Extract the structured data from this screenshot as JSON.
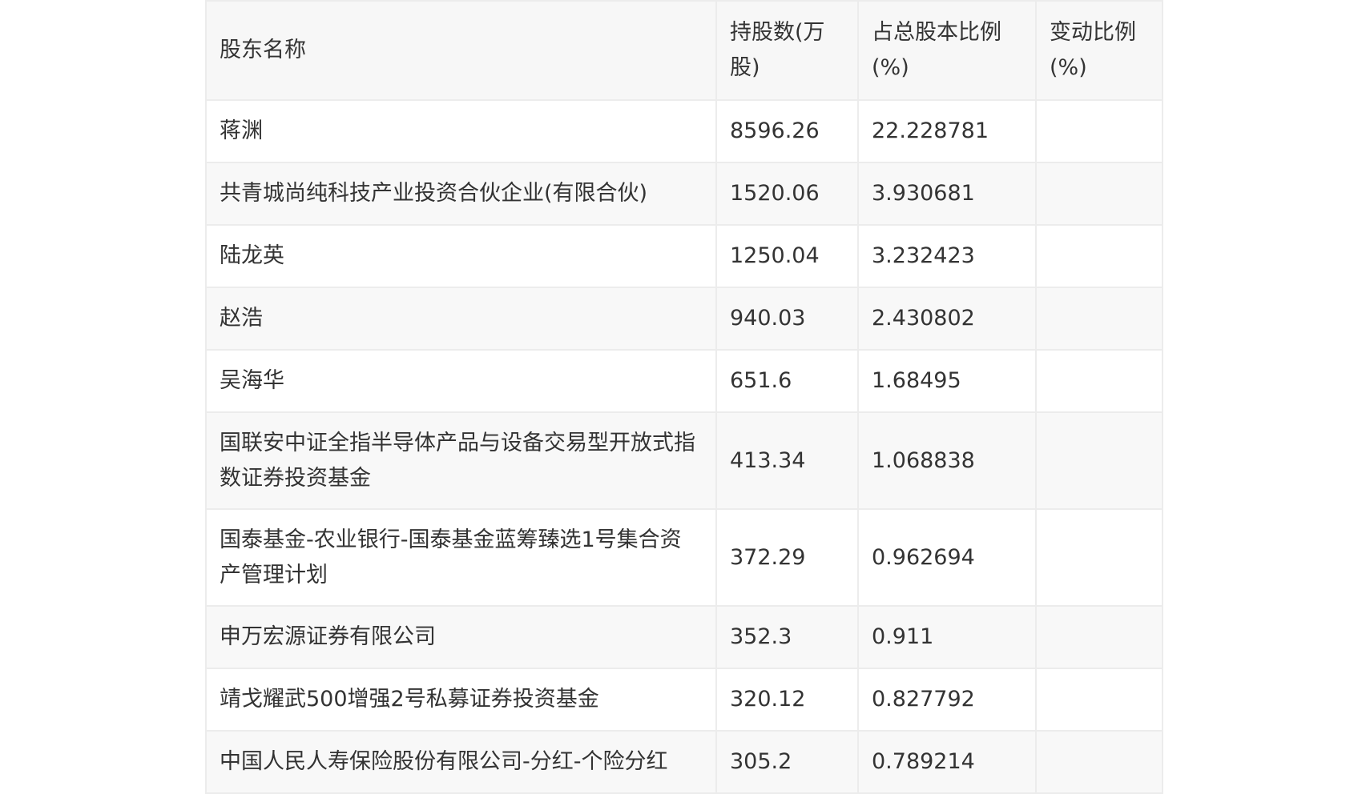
{
  "table": {
    "headers": [
      "股东名称",
      "持股数(万股)",
      "占总股本比例(%)",
      "变动比例(%)"
    ],
    "rows": [
      {
        "name": "蒋渊",
        "shares": "8596.26",
        "ratio": "22.228781",
        "change": ""
      },
      {
        "name": "共青城尚纯科技产业投资合伙企业(有限合伙)",
        "shares": "1520.06",
        "ratio": "3.930681",
        "change": ""
      },
      {
        "name": "陆龙英",
        "shares": "1250.04",
        "ratio": "3.232423",
        "change": ""
      },
      {
        "name": "赵浩",
        "shares": "940.03",
        "ratio": "2.430802",
        "change": ""
      },
      {
        "name": "吴海华",
        "shares": "651.6",
        "ratio": "1.68495",
        "change": ""
      },
      {
        "name": "国联安中证全指半导体产品与设备交易型开放式指数证券投资基金",
        "shares": "413.34",
        "ratio": "1.068838",
        "change": ""
      },
      {
        "name": "国泰基金-农业银行-国泰基金蓝筹臻选1号集合资产管理计划",
        "shares": "372.29",
        "ratio": "0.962694",
        "change": ""
      },
      {
        "name": "申万宏源证券有限公司",
        "shares": "352.3",
        "ratio": "0.911",
        "change": ""
      },
      {
        "name": "靖戈耀武500增强2号私募证券投资基金",
        "shares": "320.12",
        "ratio": "0.827792",
        "change": ""
      },
      {
        "name": "中国人民人寿保险股份有限公司-分红-个险分红",
        "shares": "305.2",
        "ratio": "0.789214",
        "change": ""
      }
    ]
  }
}
